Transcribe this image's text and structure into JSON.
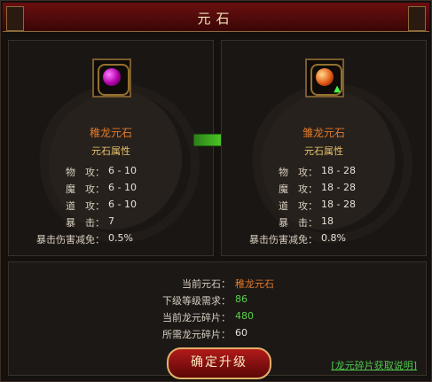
{
  "window": {
    "title": "元石"
  },
  "left": {
    "name": "稚龙元石",
    "subtitle": "元石属性",
    "stats": [
      {
        "label": "物　攻：",
        "value": "6 - 10"
      },
      {
        "label": "魔　攻：",
        "value": "6 - 10"
      },
      {
        "label": "道　攻：",
        "value": "6 - 10"
      },
      {
        "label": "暴　击：",
        "value": "7"
      },
      {
        "label": "暴击伤害减免：",
        "value": "0.5%"
      }
    ]
  },
  "right": {
    "name": "雏龙元石",
    "subtitle": "元石属性",
    "stats": [
      {
        "label": "物　攻：",
        "value": "18 - 28"
      },
      {
        "label": "魔　攻：",
        "value": "18 - 28"
      },
      {
        "label": "道　攻：",
        "value": "18 - 28"
      },
      {
        "label": "暴　击：",
        "value": "18"
      },
      {
        "label": "暴击伤害减免：",
        "value": "0.8%"
      }
    ]
  },
  "info": [
    {
      "label": "当前元石：",
      "value": "稚龙元石",
      "tone": "orange"
    },
    {
      "label": "下级等级需求：",
      "value": "86",
      "tone": "green"
    },
    {
      "label": "当前龙元碎片：",
      "value": "480",
      "tone": "green"
    },
    {
      "label": "所需龙元碎片：",
      "value": "60",
      "tone": "white"
    }
  ],
  "actions": {
    "confirm": "确定升级",
    "help_link": "[龙元碎片获取说明]"
  },
  "icons": {
    "left_item": "purple-dragon-orb-icon",
    "right_item": "red-dragon-orb-icon",
    "upgrade_arrow": "green-right-arrow-icon",
    "upgrade_indicator": "green-up-arrow-icon"
  }
}
